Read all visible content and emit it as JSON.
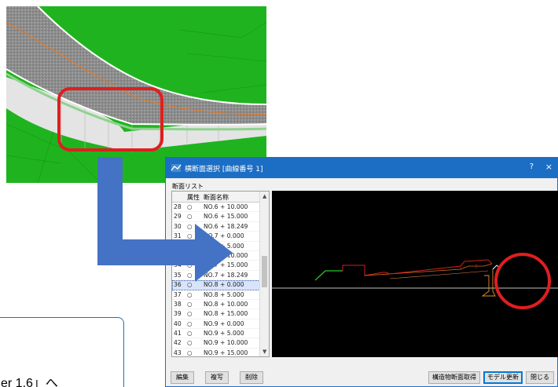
{
  "dialog": {
    "title": "横断面選択 [曲線番号 1]",
    "help_label": "?",
    "close_label": "×",
    "list_label": "断面リスト",
    "columns": {
      "attr": "属性",
      "name": "断面名称"
    },
    "rows": [
      {
        "no": "28",
        "attr": "○",
        "name": "NO.6 + 10.000"
      },
      {
        "no": "29",
        "attr": "○",
        "name": "NO.6 + 15.000"
      },
      {
        "no": "30",
        "attr": "○",
        "name": "NO.6 + 18.249"
      },
      {
        "no": "31",
        "attr": "○",
        "name": "NO.7 + 0.000"
      },
      {
        "no": "32",
        "attr": "○",
        "name": "NO.7 + 5.000"
      },
      {
        "no": "33",
        "attr": "○",
        "name": "NO.7 + 10.000"
      },
      {
        "no": "34",
        "attr": "○",
        "name": "NO.7 + 15.000"
      },
      {
        "no": "35",
        "attr": "○",
        "name": "NO.7 + 18.249"
      },
      {
        "no": "36",
        "attr": "○",
        "name": "NO.8 + 0.000",
        "selected": true
      },
      {
        "no": "37",
        "attr": "○",
        "name": "NO.8 + 5.000"
      },
      {
        "no": "38",
        "attr": "○",
        "name": "NO.8 + 10.000"
      },
      {
        "no": "39",
        "attr": "○",
        "name": "NO.8 + 15.000"
      },
      {
        "no": "40",
        "attr": "○",
        "name": "NO.9 + 0.000"
      },
      {
        "no": "41",
        "attr": "○",
        "name": "NO.9 + 5.000"
      },
      {
        "no": "42",
        "attr": "○",
        "name": "NO.9 + 10.000"
      },
      {
        "no": "43",
        "attr": "○",
        "name": "NO.9 + 15.000"
      }
    ],
    "buttons": {
      "edit": "編集",
      "copy": "複写",
      "delete": "削除",
      "get_structure": "構造物断面取得",
      "model_update": "モデル更新",
      "close": "閉じる"
    }
  },
  "callout": {
    "text": "er 1.6」へ"
  },
  "colors": {
    "title_bar": "#1c6ec4",
    "highlight_ring": "#e01e1e",
    "arrow": "#4472c4",
    "ground": "#1fb41f"
  },
  "icons": {
    "app": "cross-section-app-icon",
    "arrow": "flow-arrow"
  }
}
